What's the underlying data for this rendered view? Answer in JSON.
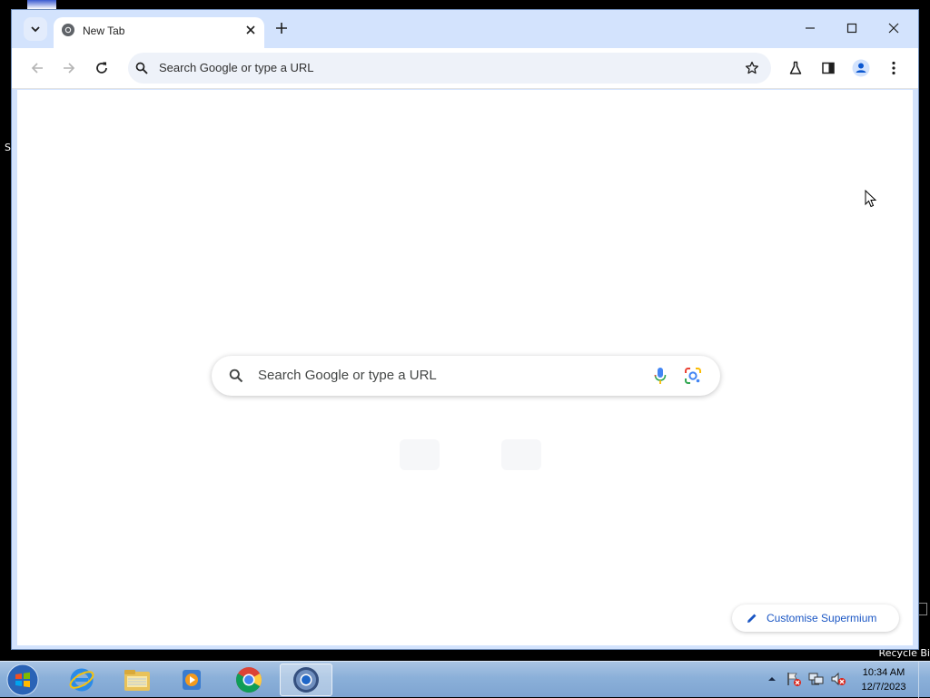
{
  "browser": {
    "tab": {
      "title": "New Tab"
    },
    "omnibox": {
      "placeholder": "Search Google or type a URL"
    },
    "accent_color": "#d3e3fd",
    "toolbar_icons": [
      "back-arrow-icon",
      "forward-arrow-icon",
      "reload-icon",
      "bookmark-star-icon",
      "labs-flask-icon",
      "side-panel-icon",
      "profile-icon",
      "more-menu-icon"
    ]
  },
  "new_tab_page": {
    "search_placeholder": "Search Google or type a URL",
    "customise_label": "Customise Supermium",
    "icons": [
      "search-icon",
      "mic-icon",
      "lens-icon",
      "pencil-icon"
    ]
  },
  "desktop": {
    "recycle_bin_label": "Recycle Bi",
    "left_label_fragment": "S"
  },
  "taskbar": {
    "pinned": [
      "internet-explorer-icon",
      "file-explorer-icon",
      "media-player-icon",
      "chrome-icon",
      "supermium-icon"
    ],
    "active_app": "supermium-icon",
    "tray_icons": [
      "tray-expand-icon",
      "action-center-flag-icon",
      "network-icon",
      "volume-muted-icon"
    ],
    "clock": {
      "time": "10:34 AM",
      "date": "12/7/2023"
    }
  }
}
